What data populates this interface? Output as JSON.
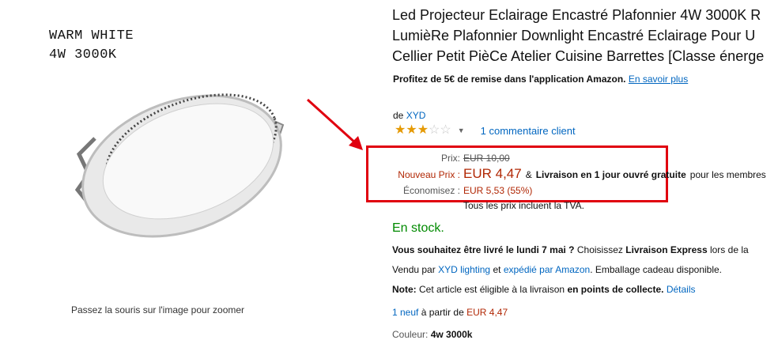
{
  "image": {
    "caption_line1": "WARM WHITE",
    "caption_line2": "4W 3000K",
    "zoom_hint": "Passez la souris sur l'image pour zoomer"
  },
  "title": {
    "line1": "Led Projecteur Eclairage Encastré Plafonnier 4W 3000K R",
    "line2": "LumièRe Plafonnier Downlight Encastré Eclairage Pour U",
    "line3": "Cellier Petit PièCe Atelier Cuisine Barrettes [Classe énerge"
  },
  "promo": {
    "text": "Profitez de 5€ de remise dans l'application Amazon.",
    "link": "En savoir plus"
  },
  "brand": {
    "prefix": "de",
    "name": "XYD"
  },
  "rating": {
    "stars": 3,
    "max": 5,
    "reviews_link": "1 commentaire client"
  },
  "price": {
    "prix_label": "Prix:",
    "old_price": "EUR 10,00",
    "nouveau_label": "Nouveau Prix :",
    "new_price": "EUR 4,47",
    "delivery_amp": "&",
    "delivery_bold": "Livraison en 1 jour ouvré gratuite",
    "delivery_rest": "pour les membres",
    "economisez_label": "Économisez :",
    "savings": "EUR 5,53 (55%)",
    "tax_note": "Tous les prix incluent la TVA."
  },
  "stock": {
    "text": "En stock."
  },
  "delivery_info": {
    "bold1": "Vous souhaitez être livré le lundi 7 mai ?",
    "text1": "Choisissez",
    "bold2": "Livraison Express",
    "text2": "lors de la"
  },
  "seller": {
    "prefix": "Vendu par",
    "seller_link": "XYD lighting",
    "and": "et",
    "shipped_link": "expédié par Amazon",
    "suffix": ". Emballage cadeau disponible."
  },
  "note": {
    "label": "Note:",
    "text": "Cet article est éligible à la livraison",
    "bold": "en points de collecte.",
    "link": "Détails"
  },
  "offers": {
    "link": "1 neuf",
    "text": "à partir de",
    "price": "EUR 4,47"
  },
  "color": {
    "label": "Couleur:",
    "value": "4w 3000k"
  },
  "colors": {
    "price_red": "#b12704",
    "link_blue": "#0066c0",
    "instock_green": "#008a00",
    "highlight_red": "#e0000f",
    "star_gold": "#e59a05"
  }
}
